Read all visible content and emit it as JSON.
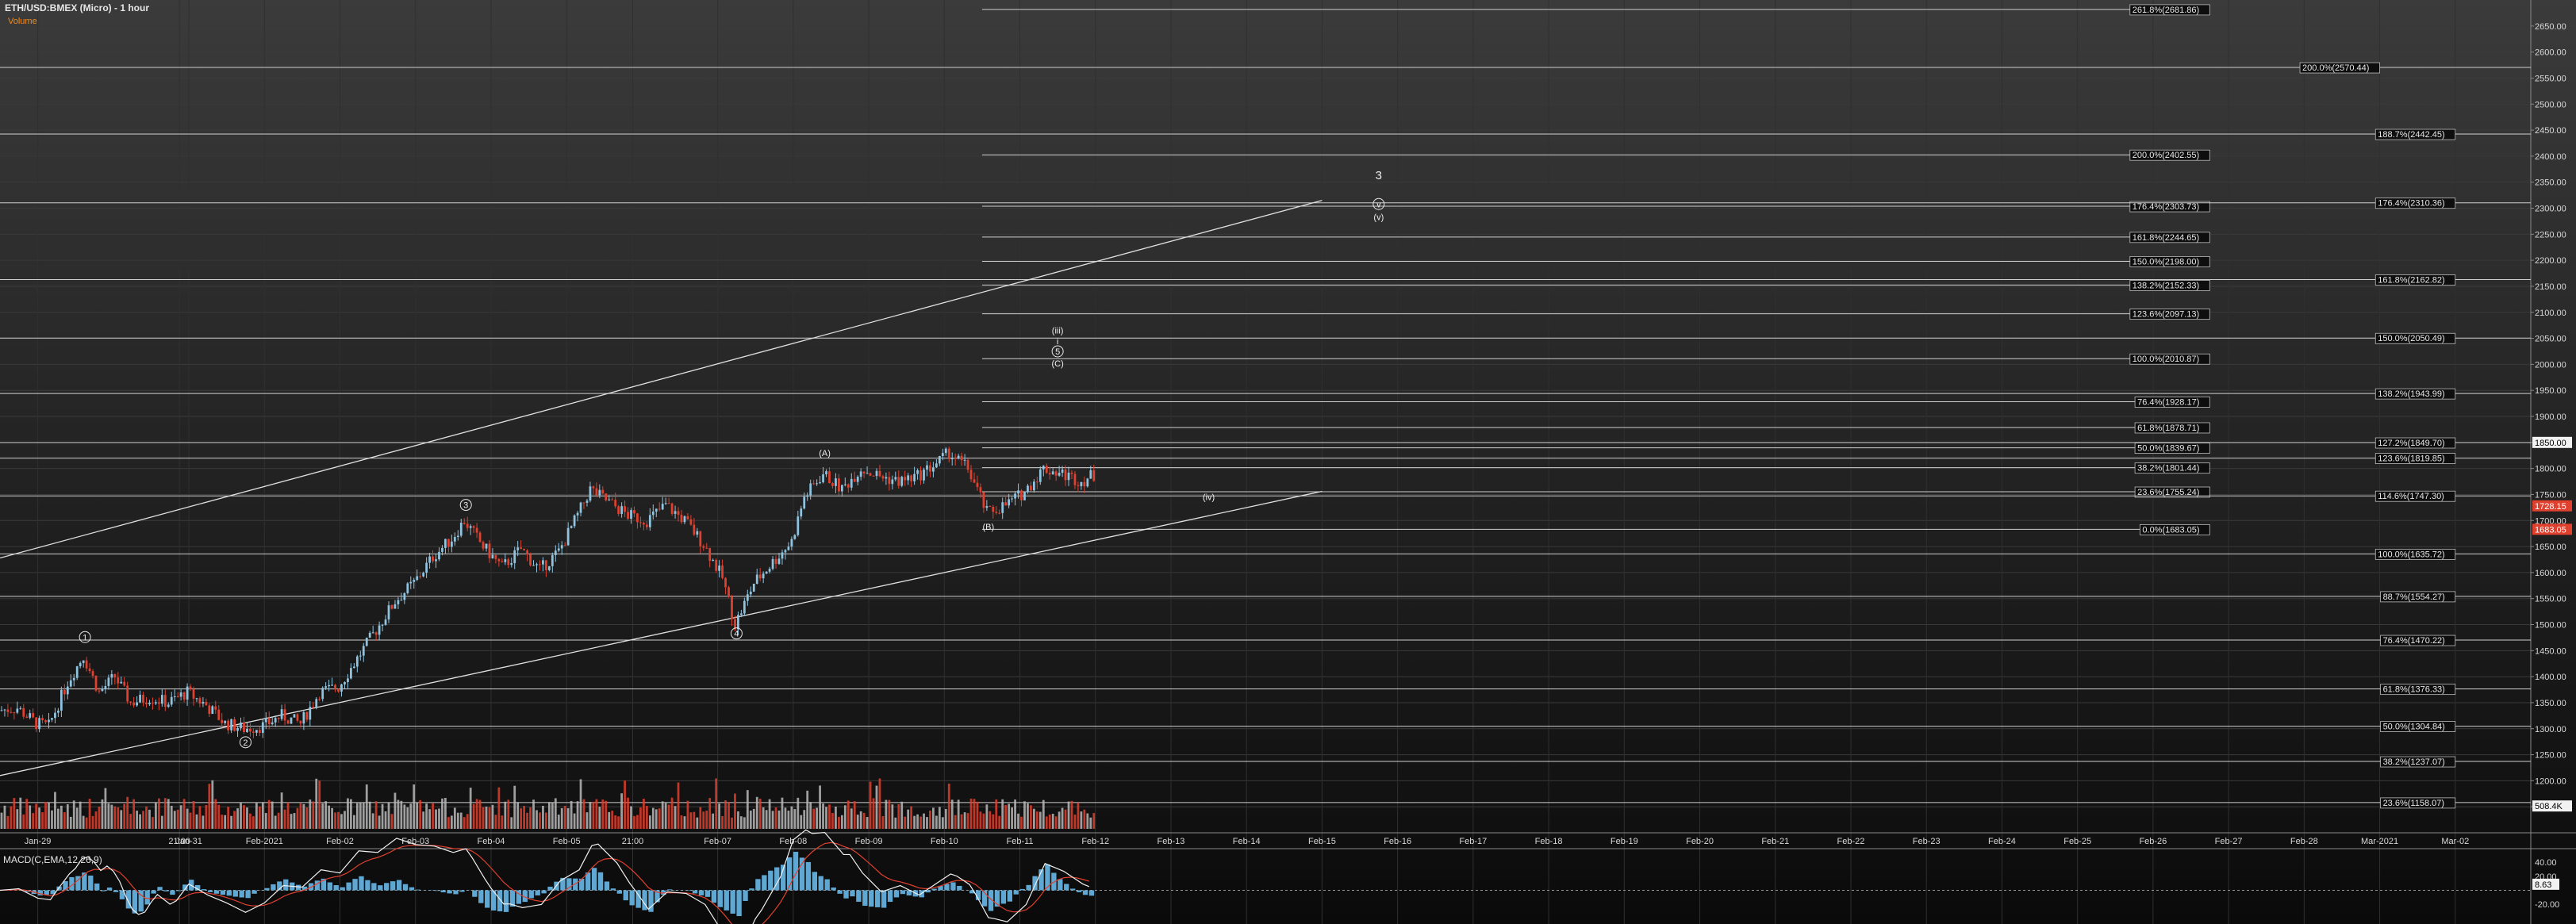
{
  "header": {
    "title": "ETH/USD:BMEX (Micro) - 1 hour",
    "volume_label": "Volume",
    "macd_label": "MACD(C,EMA,12,26,9)"
  },
  "colors": {
    "up_candle": "#8fc3df",
    "down_candle": "#e0402e",
    "volume_up": "#b9b9b9",
    "volume_down": "#e0402e",
    "macd_line": "#f0f0f0",
    "signal_line": "#e0402e",
    "histogram": "#5fa8d3",
    "level_line": "#cfcfcf",
    "current_price_tag": "#e0402e"
  },
  "chart_data": {
    "type": "candlestick",
    "title": "ETH/USD:BMEX (Micro) - 1 hour",
    "ylim": [
      1100,
      2700
    ],
    "yticks": [
      1150,
      1200,
      1250,
      1300,
      1350,
      1400,
      1450,
      1500,
      1550,
      1600,
      1650,
      1700,
      1750,
      1800,
      1850,
      1900,
      1950,
      2000,
      2050,
      2100,
      2150,
      2200,
      2250,
      2300,
      2350,
      2400,
      2450,
      2500,
      2550,
      2600,
      2650
    ],
    "ytick_labels": [
      "1150.00",
      "1200.00",
      "1250.00",
      "1300.00",
      "1350.00",
      "1400.00",
      "1450.00",
      "1500.00",
      "1550.00",
      "1600.00",
      "1650.00",
      "1700.00",
      "1750.00",
      "1800.00",
      "1850.00",
      "1900.00",
      "1950.00",
      "2000.00",
      "2050.00",
      "2100.00",
      "2150.00",
      "2200.00",
      "2250.00",
      "2300.00",
      "2350.00",
      "2400.00",
      "2450.00",
      "2500.00",
      "2550.00",
      "2600.00",
      "2650.00"
    ],
    "x_start": "Jan-28 12:00",
    "x_end": "Mar-03 00:00",
    "xticks": [
      {
        "t": "Jan-29 00:00",
        "label": "Jan-29"
      },
      {
        "t": "Jan-30 21:00",
        "label": "21:00"
      },
      {
        "t": "Jan-31 00:00",
        "label": "Jan-31"
      },
      {
        "t": "Feb-01 00:00",
        "label": "Feb-2021"
      },
      {
        "t": "Feb-02 00:00",
        "label": "Feb-02"
      },
      {
        "t": "Feb-03 00:00",
        "label": "Feb-03"
      },
      {
        "t": "Feb-04 00:00",
        "label": "Feb-04"
      },
      {
        "t": "Feb-05 00:00",
        "label": "Feb-05"
      },
      {
        "t": "Feb-05 21:00",
        "label": "21:00"
      },
      {
        "t": "Feb-07 00:00",
        "label": "Feb-07"
      },
      {
        "t": "Feb-08 00:00",
        "label": "Feb-08"
      },
      {
        "t": "Feb-09 00:00",
        "label": "Feb-09"
      },
      {
        "t": "Feb-10 00:00",
        "label": "Feb-10"
      },
      {
        "t": "Feb-11 00:00",
        "label": "Feb-11"
      },
      {
        "t": "Feb-12 00:00",
        "label": "Feb-12"
      },
      {
        "t": "Feb-13 00:00",
        "label": "Feb-13"
      },
      {
        "t": "Feb-14 00:00",
        "label": "Feb-14"
      },
      {
        "t": "Feb-15 00:00",
        "label": "Feb-15"
      },
      {
        "t": "Feb-16 00:00",
        "label": "Feb-16"
      },
      {
        "t": "Feb-17 00:00",
        "label": "Feb-17"
      },
      {
        "t": "Feb-18 00:00",
        "label": "Feb-18"
      },
      {
        "t": "Feb-19 00:00",
        "label": "Feb-19"
      },
      {
        "t": "Feb-20 00:00",
        "label": "Feb-20"
      },
      {
        "t": "Feb-21 00:00",
        "label": "Feb-21"
      },
      {
        "t": "Feb-22 00:00",
        "label": "Feb-22"
      },
      {
        "t": "Feb-23 00:00",
        "label": "Feb-23"
      },
      {
        "t": "Feb-24 00:00",
        "label": "Feb-24"
      },
      {
        "t": "Feb-25 00:00",
        "label": "Feb-25"
      },
      {
        "t": "Feb-26 00:00",
        "label": "Feb-26"
      },
      {
        "t": "Feb-27 00:00",
        "label": "Feb-27"
      },
      {
        "t": "Feb-28 00:00",
        "label": "Feb-28"
      },
      {
        "t": "Mar-01 00:00",
        "label": "Mar-2021"
      },
      {
        "t": "Mar-02 00:00",
        "label": "Mar-02"
      }
    ],
    "price_path": [
      [
        "Jan-28 12:00",
        1335
      ],
      [
        "Jan-28 18:00",
        1340
      ],
      [
        "Jan-29 00:00",
        1310
      ],
      [
        "Jan-29 04:00",
        1305
      ],
      [
        "Jan-29 10:00",
        1390
      ],
      [
        "Jan-29 15:00",
        1440
      ],
      [
        "Jan-29 20:00",
        1370
      ],
      [
        "Jan-30 01:00",
        1400
      ],
      [
        "Jan-30 06:00",
        1350
      ],
      [
        "Jan-30 12:00",
        1360
      ],
      [
        "Jan-30 18:00",
        1350
      ],
      [
        "Jan-31 00:00",
        1370
      ],
      [
        "Jan-31 06:00",
        1345
      ],
      [
        "Jan-31 12:00",
        1310
      ],
      [
        "Jan-31 18:00",
        1300
      ],
      [
        "Feb-01 00:00",
        1305
      ],
      [
        "Feb-01 06:00",
        1325
      ],
      [
        "Feb-01 12:00",
        1310
      ],
      [
        "Feb-01 18:00",
        1370
      ],
      [
        "Feb-02 00:00",
        1380
      ],
      [
        "Feb-02 06:00",
        1435
      ],
      [
        "Feb-02 12:00",
        1490
      ],
      [
        "Feb-02 18:00",
        1545
      ],
      [
        "Feb-03 00:00",
        1580
      ],
      [
        "Feb-03 06:00",
        1630
      ],
      [
        "Feb-03 12:00",
        1665
      ],
      [
        "Feb-03 16:00",
        1700
      ],
      [
        "Feb-03 22:00",
        1650
      ],
      [
        "Feb-04 04:00",
        1610
      ],
      [
        "Feb-04 10:00",
        1645
      ],
      [
        "Feb-04 16:00",
        1605
      ],
      [
        "Feb-04 22:00",
        1640
      ],
      [
        "Feb-05 04:00",
        1710
      ],
      [
        "Feb-05 08:00",
        1760
      ],
      [
        "Feb-05 14:00",
        1735
      ],
      [
        "Feb-05 20:00",
        1710
      ],
      [
        "Feb-06 02:00",
        1700
      ],
      [
        "Feb-06 08:00",
        1730
      ],
      [
        "Feb-06 14:00",
        1700
      ],
      [
        "Feb-06 20:00",
        1655
      ],
      [
        "Feb-07 02:00",
        1590
      ],
      [
        "Feb-07 06:00",
        1500
      ],
      [
        "Feb-07 12:00",
        1580
      ],
      [
        "Feb-07 18:00",
        1620
      ],
      [
        "Feb-08 00:00",
        1660
      ],
      [
        "Feb-08 04:00",
        1745
      ],
      [
        "Feb-08 10:00",
        1790
      ],
      [
        "Feb-08 16:00",
        1760
      ],
      [
        "Feb-08 22:00",
        1800
      ],
      [
        "Feb-09 04:00",
        1785
      ],
      [
        "Feb-09 10:00",
        1775
      ],
      [
        "Feb-09 16:00",
        1785
      ],
      [
        "Feb-09 22:00",
        1810
      ],
      [
        "Feb-10 02:00",
        1830
      ],
      [
        "Feb-10 08:00",
        1800
      ],
      [
        "Feb-10 14:00",
        1715
      ],
      [
        "Feb-10 20:00",
        1730
      ],
      [
        "Feb-11 02:00",
        1755
      ],
      [
        "Feb-11 08:00",
        1800
      ],
      [
        "Feb-11 14:00",
        1790
      ],
      [
        "Feb-11 20:00",
        1775
      ],
      [
        "Feb-11 23:00",
        1785
      ]
    ],
    "overlay_lines": [
      {
        "x1": "Jan-28 12:00",
        "y1": 1628,
        "x2": "Feb-15 00:00",
        "y2": 2315
      },
      {
        "x1": "Jan-28 12:00",
        "y1": 1210,
        "x2": "Feb-15 00:00",
        "y2": 1756
      }
    ],
    "levels": [
      {
        "value": 2681.86,
        "label": "261.8%(2681.86)",
        "x_from": "Feb-10 12:00",
        "x_to": "Feb-26 18:00",
        "tag_at": "Feb-26 18:00"
      },
      {
        "value": 2570.44,
        "label": "200.0%(2570.44)",
        "x_from": "Jan-28 12:00",
        "x_to": "Mar-03 00:00",
        "tag_at": "Mar-01 00:00"
      },
      {
        "value": 2442.45,
        "label": "188.7%(2442.45)",
        "x_from": "Jan-28 12:00",
        "x_to": "Mar-03 00:00",
        "tag_at": "Mar-02 00:00"
      },
      {
        "value": 2402.55,
        "label": "200.0%(2402.55)",
        "x_from": "Feb-10 12:00",
        "x_to": "Feb-26 18:00",
        "tag_at": "Feb-26 18:00"
      },
      {
        "value": 2303.73,
        "label": "176.4%(2303.73)",
        "x_from": "Feb-10 12:00",
        "x_to": "Feb-26 18:00",
        "tag_at": "Feb-26 18:00"
      },
      {
        "value": 2310.36,
        "label": "176.4%(2310.36)",
        "x_from": "Jan-28 12:00",
        "x_to": "Mar-03 00:00",
        "tag_at": "Mar-02 00:00"
      },
      {
        "value": 2244.65,
        "label": "161.8%(2244.65)",
        "x_from": "Feb-10 12:00",
        "x_to": "Feb-26 18:00",
        "tag_at": "Feb-26 18:00"
      },
      {
        "value": 2198.0,
        "label": "150.0%(2198.00)",
        "x_from": "Feb-10 12:00",
        "x_to": "Feb-26 18:00",
        "tag_at": "Feb-26 18:00"
      },
      {
        "value": 2152.33,
        "label": "138.2%(2152.33)",
        "x_from": "Feb-10 12:00",
        "x_to": "Feb-26 18:00",
        "tag_at": "Feb-26 18:00"
      },
      {
        "value": 2162.82,
        "label": "161.8%(2162.82)",
        "x_from": "Jan-28 12:00",
        "x_to": "Mar-03 00:00",
        "tag_at": "Mar-02 00:00"
      },
      {
        "value": 2097.13,
        "label": "123.6%(2097.13)",
        "x_from": "Feb-10 12:00",
        "x_to": "Feb-26 18:00",
        "tag_at": "Feb-26 18:00"
      },
      {
        "value": 2050.49,
        "label": "150.0%(2050.49)",
        "x_from": "Jan-28 12:00",
        "x_to": "Mar-03 00:00",
        "tag_at": "Mar-02 00:00"
      },
      {
        "value": 2010.87,
        "label": "100.0%(2010.87)",
        "x_from": "Feb-10 12:00",
        "x_to": "Feb-26 18:00",
        "tag_at": "Feb-26 18:00"
      },
      {
        "value": 1943.99,
        "label": "138.2%(1943.99)",
        "x_from": "Jan-28 12:00",
        "x_to": "Mar-03 00:00",
        "tag_at": "Mar-02 00:00"
      },
      {
        "value": 1928.17,
        "label": "76.4%(1928.17)",
        "x_from": "Feb-10 12:00",
        "x_to": "Feb-26 18:00",
        "tag_at": "Feb-26 18:00"
      },
      {
        "value": 1878.71,
        "label": "61.8%(1878.71)",
        "x_from": "Feb-10 12:00",
        "x_to": "Feb-26 18:00",
        "tag_at": "Feb-26 18:00"
      },
      {
        "value": 1849.7,
        "label": "127.2%(1849.70)",
        "x_from": "Jan-28 12:00",
        "x_to": "Mar-03 00:00",
        "tag_at": "Mar-02 00:00"
      },
      {
        "value": 1839.67,
        "label": "50.0%(1839.67)",
        "x_from": "Feb-10 12:00",
        "x_to": "Feb-26 18:00",
        "tag_at": "Feb-26 18:00"
      },
      {
        "value": 1819.85,
        "label": "123.6%(1819.85)",
        "x_from": "Jan-28 12:00",
        "x_to": "Mar-03 00:00",
        "tag_at": "Mar-02 00:00"
      },
      {
        "value": 1801.44,
        "label": "38.2%(1801.44)",
        "x_from": "Feb-10 12:00",
        "x_to": "Feb-26 18:00",
        "tag_at": "Feb-26 18:00"
      },
      {
        "value": 1755.24,
        "label": "23.6%(1755.24)",
        "x_from": "Feb-10 12:00",
        "x_to": "Feb-26 18:00",
        "tag_at": "Feb-26 18:00"
      },
      {
        "value": 1747.3,
        "label": "114.6%(1747.30)",
        "x_from": "Jan-28 12:00",
        "x_to": "Mar-03 00:00",
        "tag_at": "Mar-02 00:00"
      },
      {
        "value": 1683.05,
        "label": "0.0%(1683.05)",
        "x_from": "Feb-10 12:00",
        "x_to": "Feb-26 18:00",
        "tag_at": "Feb-26 18:00"
      },
      {
        "value": 1635.72,
        "label": "100.0%(1635.72)",
        "x_from": "Jan-28 12:00",
        "x_to": "Mar-03 00:00",
        "tag_at": "Mar-02 00:00"
      },
      {
        "value": 1554.27,
        "label": "88.7%(1554.27)",
        "x_from": "Jan-28 12:00",
        "x_to": "Mar-03 00:00",
        "tag_at": "Mar-02 00:00"
      },
      {
        "value": 1470.22,
        "label": "76.4%(1470.22)",
        "x_from": "Jan-28 12:00",
        "x_to": "Mar-03 00:00",
        "tag_at": "Mar-02 00:00"
      },
      {
        "value": 1376.33,
        "label": "61.8%(1376.33)",
        "x_from": "Jan-28 12:00",
        "x_to": "Mar-03 00:00",
        "tag_at": "Mar-02 00:00"
      },
      {
        "value": 1304.84,
        "label": "50.0%(1304.84)",
        "x_from": "Jan-28 12:00",
        "x_to": "Mar-03 00:00",
        "tag_at": "Mar-02 00:00"
      },
      {
        "value": 1237.07,
        "label": "38.2%(1237.07)",
        "x_from": "Jan-28 12:00",
        "x_to": "Mar-03 00:00",
        "tag_at": "Mar-02 00:00"
      },
      {
        "value": 1158.07,
        "label": "23.6%(1158.07)",
        "x_from": "Jan-28 12:00",
        "x_to": "Mar-03 00:00",
        "tag_at": "Mar-02 00:00"
      }
    ],
    "price_tags": [
      {
        "value": 1850.0,
        "label": "1850.00",
        "style": "white"
      },
      {
        "value": 1728.15,
        "label": "1728.15",
        "style": "red"
      },
      {
        "value": 1683.05,
        "label": "1683.05",
        "style": "red"
      }
    ],
    "wave_labels": [
      {
        "text": "1",
        "t": "Jan-29 15:00",
        "y": 1476,
        "circled": true
      },
      {
        "text": "2",
        "t": "Jan-31 18:00",
        "y": 1274,
        "circled": true
      },
      {
        "text": "3",
        "t": "Feb-03 16:00",
        "y": 1730,
        "circled": true
      },
      {
        "text": "4",
        "t": "Feb-07 06:00",
        "y": 1483,
        "circled": true
      },
      {
        "text": "(A)",
        "t": "Feb-08 10:00",
        "y": 1830,
        "circled": false
      },
      {
        "text": "(B)",
        "t": "Feb-10 14:00",
        "y": 1688,
        "circled": false
      },
      {
        "text": "(iii)",
        "t": "Feb-11 12:00",
        "y": 2065,
        "circled": false
      },
      {
        "text": "i",
        "t": "Feb-11 12:00",
        "y": 2045,
        "circled": false
      },
      {
        "text": "5",
        "t": "Feb-11 12:00",
        "y": 2025,
        "circled": true
      },
      {
        "text": "(C)",
        "t": "Feb-11 12:00",
        "y": 2002,
        "circled": false
      },
      {
        "text": "(iv)",
        "t": "Feb-13 12:00",
        "y": 1745,
        "circled": false
      },
      {
        "text": "3",
        "t": "Feb-15 18:00",
        "y": 2362,
        "circled": false
      },
      {
        "text": "v",
        "t": "Feb-15 18:00",
        "y": 2308,
        "circled": true
      },
      {
        "text": "(v)",
        "t": "Feb-15 18:00",
        "y": 2283,
        "circled": false
      }
    ],
    "volume": {
      "ylim": [
        0,
        1500
      ],
      "last_label": "508.4K",
      "last_value": 508.4,
      "unit": "K",
      "typical_max": 1200
    },
    "macd": {
      "name": "MACD(C,EMA,12,26,9)",
      "ylim": [
        -50,
        50
      ],
      "ytick_labels": [
        "40.00",
        "20.00",
        "-20.00"
      ],
      "yticks": [
        40,
        20,
        -20
      ],
      "macd_last_label": "8.63",
      "macd_last": 8.63,
      "signal_last": 6.5
    }
  }
}
